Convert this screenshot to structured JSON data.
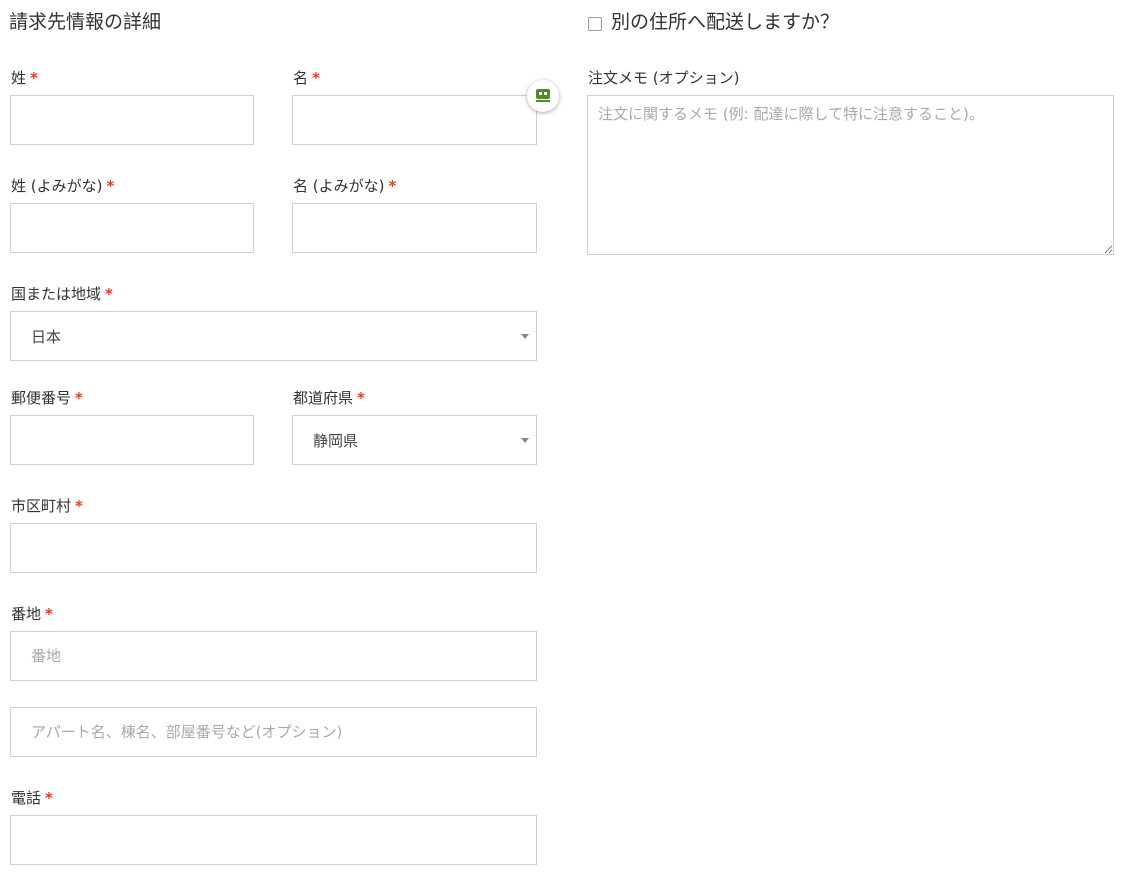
{
  "billing": {
    "title": "請求先情報の詳細",
    "required_mark": "*",
    "last_name": {
      "label": "姓",
      "value": ""
    },
    "first_name": {
      "label": "名",
      "value": ""
    },
    "last_name_kana": {
      "label": "姓 (よみがな)",
      "value": ""
    },
    "first_name_kana": {
      "label": "名 (よみがな)",
      "value": ""
    },
    "country": {
      "label": "国または地域",
      "selected": "日本"
    },
    "postcode": {
      "label": "郵便番号",
      "value": ""
    },
    "state": {
      "label": "都道府県",
      "selected": "静岡県"
    },
    "city": {
      "label": "市区町村",
      "value": ""
    },
    "address_1": {
      "label": "番地",
      "placeholder": "番地",
      "value": ""
    },
    "address_2": {
      "placeholder": "アパート名、棟名、部屋番号など(オプション)",
      "value": ""
    },
    "phone": {
      "label": "電話",
      "value": ""
    }
  },
  "shipping": {
    "ship_different_label": "別の住所へ配送しますか？",
    "ship_different_checked": false,
    "order_notes": {
      "label": "注文メモ (オプション)",
      "placeholder": "注文に関するメモ (例: 配達に際して特に注意すること)。",
      "value": ""
    }
  },
  "colors": {
    "required": "#e2401c",
    "border": "#d3ced2",
    "text": "#333333",
    "placeholder": "#a9a9a9",
    "badge_icon": "#4a8c2a"
  },
  "icons": {
    "autofill_badge": "robot-icon",
    "select_caret": "caret-down-icon"
  }
}
